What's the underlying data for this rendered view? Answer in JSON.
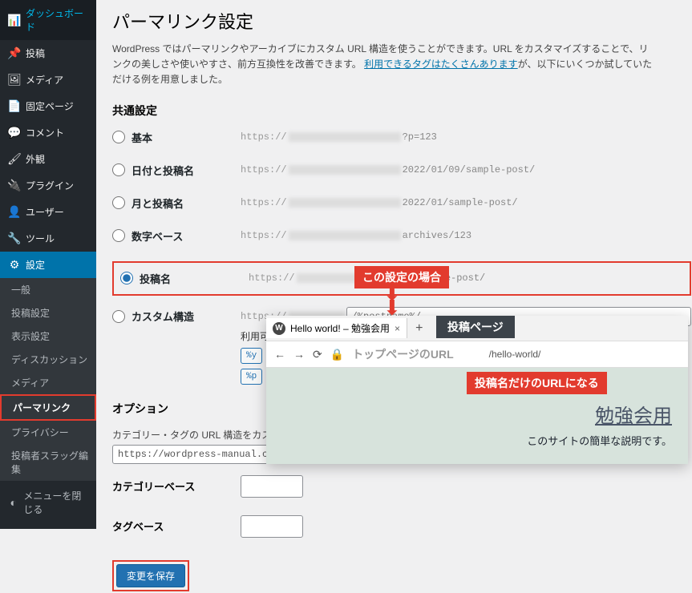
{
  "sidebar": {
    "items": [
      {
        "icon": "📊",
        "label": "ダッシュボード"
      },
      {
        "icon": "📌",
        "label": "投稿"
      },
      {
        "icon": "🖼",
        "label": "メディア"
      },
      {
        "icon": "📄",
        "label": "固定ページ"
      },
      {
        "icon": "💬",
        "label": "コメント"
      },
      {
        "icon": "🖌",
        "label": "外観"
      },
      {
        "icon": "🔌",
        "label": "プラグイン"
      },
      {
        "icon": "👤",
        "label": "ユーザー"
      },
      {
        "icon": "🔧",
        "label": "ツール"
      },
      {
        "icon": "⚙",
        "label": "設定"
      }
    ],
    "sub": [
      "一般",
      "投稿設定",
      "表示設定",
      "ディスカッション",
      "メディア",
      "パーマリンク",
      "プライバシー",
      "投稿者スラッグ編集"
    ],
    "collapse": "メニューを閉じる"
  },
  "page": {
    "title": "パーマリンク設定",
    "desc1": "WordPress ではパーマリンクやアーカイブにカスタム URL 構造を使うことができます。URL をカスタマイズすることで、リンクの美しさや使いやすさ、前方互換性を改善できます。",
    "desc_link": "利用できるタグはたくさんあります",
    "desc2": "が、以下にいくつか試していただける例を用意しました。",
    "section_common": "共通設定",
    "radios": {
      "plain": {
        "label": "基本",
        "prefix": "https://",
        "suffix": "?p=123"
      },
      "date": {
        "label": "日付と投稿名",
        "prefix": "https://",
        "suffix": "2022/01/09/sample-post/"
      },
      "month": {
        "label": "月と投稿名",
        "prefix": "https://",
        "suffix": "2022/01/sample-post/"
      },
      "numeric": {
        "label": "数字ベース",
        "prefix": "https://",
        "suffix": "archives/123"
      },
      "postname": {
        "label": "投稿名",
        "prefix": "https://",
        "suffix": "/sample-post/"
      },
      "custom": {
        "label": "カスタム構造",
        "prefix": "https://",
        "value": "/%postname%/",
        "available": "利用可能なタグ:",
        "t1": "%y",
        "t2": "%p"
      }
    },
    "section_opt": "オプション",
    "opt_desc": "カテゴリー・タグの URL 構造をカスタマイ",
    "opt_example": "https://wordpress-manual.com/wp-st",
    "cat_label": "カテゴリーベース",
    "tag_label": "タグベース",
    "submit": "変更を保存"
  },
  "anno": {
    "case": "この設定の場合",
    "tabhead": "投稿ページ",
    "urlnote": "投稿名だけのURLになる"
  },
  "browser": {
    "tab_title": "Hello world! – 勉強会用",
    "url_label": "トップページのURL",
    "url_path": "/hello-world/",
    "site_title": "勉強会用",
    "site_desc": "このサイトの簡単な説明です。"
  }
}
